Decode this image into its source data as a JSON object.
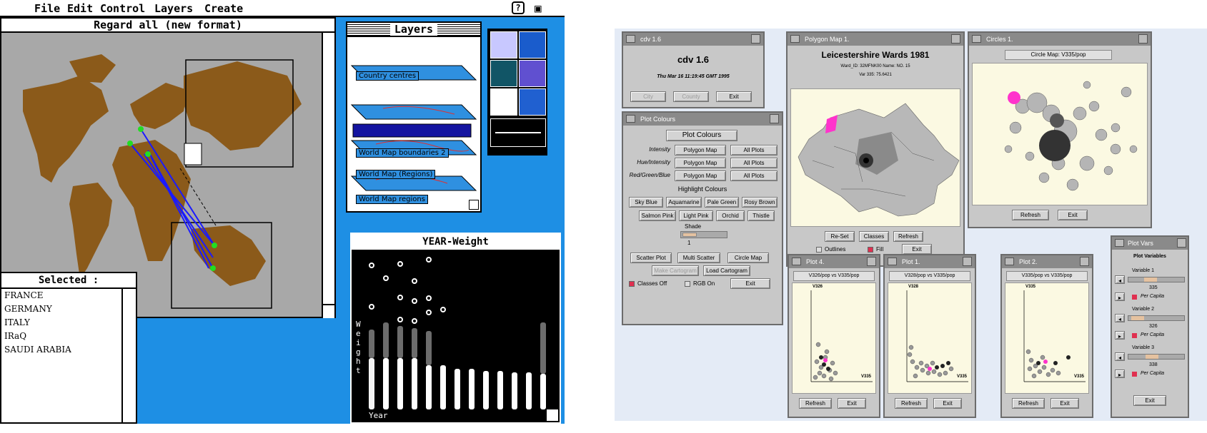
{
  "left_screen": {
    "menu": {
      "file": "File",
      "edit": "Edit",
      "control": "Control",
      "layers": "Layers",
      "create": "Create"
    },
    "map_window": {
      "title": "Regard all (new format)"
    },
    "selected_panel": {
      "title": "Selected :",
      "items": [
        "FRANCE",
        "GERMANY",
        "ITALY",
        "IRaQ",
        "SAUDI ARABIA"
      ]
    },
    "layers_window": {
      "title": "Layers",
      "layers": [
        "Country centres",
        "World Map boundaries 2",
        "World Map (Regions)",
        "World Map regions"
      ]
    },
    "year_weight_window": {
      "title": "YEAR-Weight",
      "y_axis_label": "Weight",
      "x_axis_label": "Year"
    },
    "colors": {
      "desktop": "#1e8fe4",
      "land": "#8b5a1a",
      "map_bg": "#a8a8a8",
      "links": "#1a1aff",
      "points": "#22dd22"
    }
  },
  "right_screen": {
    "cdv_window": {
      "title": "cdv 1.6",
      "heading": "cdv 1.6",
      "date": "Thu Mar 16 11:19:45 GMT 1995",
      "buttons": {
        "city": "City",
        "county": "County",
        "exit": "Exit"
      }
    },
    "plot_colours_window": {
      "title": "Plot Colours",
      "header": "Plot Colours",
      "rows": [
        {
          "label": "Intensity",
          "b1": "Polygon Map",
          "b2": "All Plots"
        },
        {
          "label": "Hue/Intensity",
          "b1": "Polygon Map",
          "b2": "All Plots"
        },
        {
          "label": "Red/Green/Blue",
          "b1": "Polygon Map",
          "b2": "All Plots"
        }
      ],
      "highlight_header": "Highlight Colours",
      "highlight_row1": [
        "Sky Blue",
        "Aquamarine",
        "Pale Green",
        "Rosy Brown"
      ],
      "highlight_row2": [
        "Salmon Pink",
        "Light Pink",
        "Orchid",
        "Thistle"
      ],
      "shade_label": "Shade",
      "shade_value": "1",
      "plot_buttons": [
        "Scatter Plot",
        "Multi Scatter",
        "Circle Map"
      ],
      "cart_buttons": [
        "Make Cartogram",
        "Load Cartogram"
      ],
      "classes_off": "Classes Off",
      "rgb_on": "RGB On",
      "exit": "Exit"
    },
    "polygon_map_window": {
      "title": "Polygon Map 1.",
      "heading": "Leicestershire Wards 1981",
      "info1": "Ward_ID: 32MFNK00 Name: NO. 15",
      "info2": "Var 335: 75.6421",
      "buttons": {
        "reset": "Re-Set",
        "classes": "Classes",
        "refresh": "Refresh"
      },
      "outlines": "Outlines",
      "fill": "Fill",
      "exit": "Exit"
    },
    "circles_window": {
      "title": "Circles 1.",
      "caption": "Circle Map: V335/pop",
      "refresh": "Refresh",
      "exit": "Exit"
    },
    "scatter_plots": [
      {
        "title": "Plot 4.",
        "caption": "V326/pop vs V335/pop",
        "yvar": "V326",
        "xvar": "V335",
        "refresh": "Refresh",
        "exit": "Exit"
      },
      {
        "title": "Plot 1.",
        "caption": "V328/pop vs V335/pop",
        "yvar": "V328",
        "xvar": "V335",
        "refresh": "Refresh",
        "exit": "Exit"
      },
      {
        "title": "Plot 2.",
        "caption": "V335/pop vs V335/pop",
        "yvar": "V335",
        "xvar": "V335",
        "refresh": "Refresh",
        "exit": "Exit"
      }
    ],
    "plot_vars_window": {
      "title": "Plot Vars",
      "header": "Plot Variables",
      "vars": [
        {
          "label": "Variable 1",
          "value": "335",
          "per_capita": "Per Capita"
        },
        {
          "label": "Variable 2",
          "value": "326",
          "per_capita": "Per Capita"
        },
        {
          "label": "Variable 3",
          "value": "338",
          "per_capita": "Per Capita"
        }
      ],
      "exit": "Exit"
    },
    "colors": {
      "desktop": "#e4ebf6",
      "window": "#c8c8c8",
      "titlebar": "#8a8a8a",
      "plot_bg": "#fbf9e2",
      "highlight": "#ff33cc"
    }
  }
}
